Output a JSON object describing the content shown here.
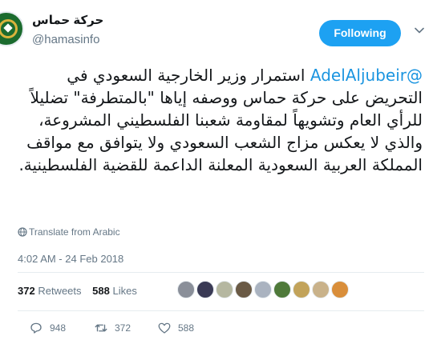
{
  "author": {
    "display_name": "حركة حماس",
    "handle": "@hamasinfo",
    "avatar_icon": "hamas-logo-icon"
  },
  "follow_button": {
    "label": "Following",
    "color": "#1da1f2"
  },
  "tweet": {
    "mention": "@AdelAljubeir",
    "body": " استمرار وزير الخارجية السعودي في التحريض على حركة حماس ووصفه إياها \"بالمتطرفة\" تضليلاً للرأي العام وتشويهاً لمقاومة شعبنا الفلسطيني المشروعة، والذي لا يعكس مزاج الشعب السعودي ولا يتوافق مع مواقف المملكة العربية السعودية المعلنة الداعمة للقضية الفلسطينية.",
    "mention_color": "#1b95e0"
  },
  "translate_label": "Translate from Arabic",
  "timestamp": "4:02 AM - 24 Feb 2018",
  "stats": {
    "retweets_count": "372",
    "retweets_label": "Retweets",
    "likes_count": "588",
    "likes_label": "Likes"
  },
  "likers": [
    {
      "color": "#8a8f99"
    },
    {
      "color": "#3a3a55"
    },
    {
      "color": "#b5b7a0"
    },
    {
      "color": "#6a5a45"
    },
    {
      "color": "#aab3c0"
    },
    {
      "color": "#4f7a3a"
    },
    {
      "color": "#c2a35a"
    },
    {
      "color": "#c9b28a"
    },
    {
      "color": "#d98e3a"
    }
  ],
  "actions": {
    "reply_count": "948",
    "retweet_count": "372",
    "like_count": "588"
  }
}
